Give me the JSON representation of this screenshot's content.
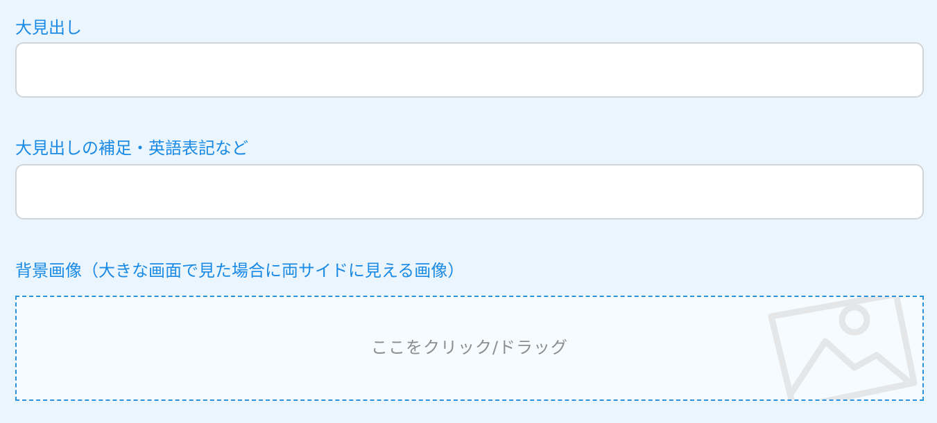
{
  "form": {
    "heading_label": "大見出し",
    "heading_value": "",
    "subheading_label": "大見出しの補足・英語表記など",
    "subheading_value": "",
    "background_label": "背景画像（大きな画面で見た場合に両サイドに見える画像）",
    "dropzone_text": "ここをクリック/ドラッグ",
    "dropzone_icon": "image-placeholder-icon"
  },
  "colors": {
    "background": "#eaf5fd",
    "label": "#1a8ae4",
    "input_border": "#cfd4d9",
    "dropzone_border": "#2a90d8",
    "dropzone_text": "#8d8d8d"
  }
}
